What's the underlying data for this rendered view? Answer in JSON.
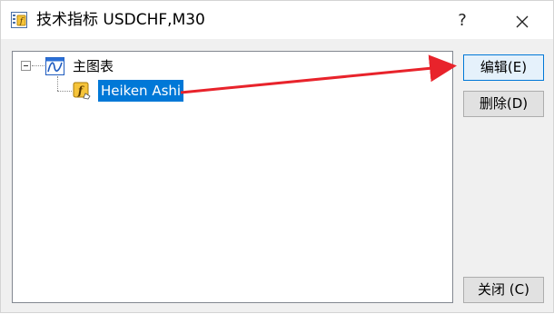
{
  "window": {
    "title": "技术指标 USDCHF,M30",
    "help_glyph": "?",
    "title_icon": "indicator-app-icon",
    "close_icon": "close-icon"
  },
  "tree": {
    "root": {
      "label": "主图表",
      "icon": "main-chart-icon",
      "expanded": true
    },
    "children": [
      {
        "label": "Heiken Ashi",
        "icon": "custom-indicator-f-icon",
        "selected": true
      }
    ]
  },
  "buttons": {
    "edit": "编辑(E)",
    "delete": "删除(D)",
    "close": "关闭 (C)"
  },
  "annotation": {
    "color": "#e8232b",
    "from": "selected-item",
    "to": "edit-button"
  }
}
